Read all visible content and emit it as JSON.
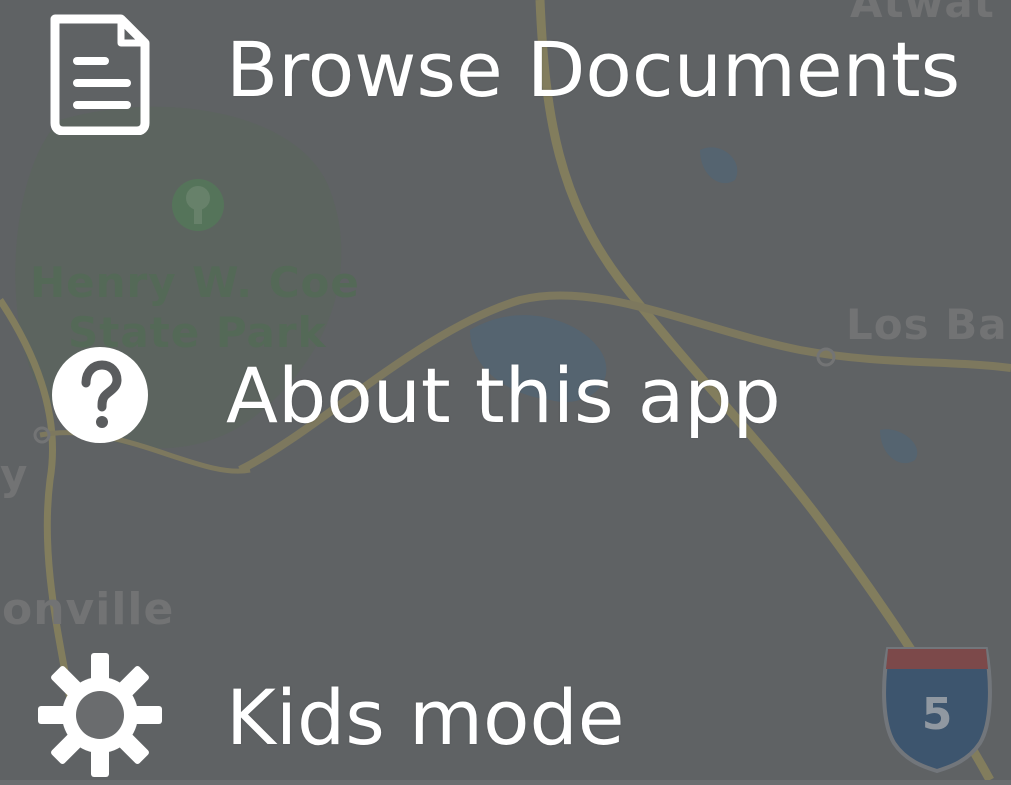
{
  "map": {
    "labels": {
      "top_right": "Atwat",
      "park_line1": "Henry W. Coe",
      "park_line2": "State Park",
      "los_banos": "Los Ba",
      "left_y": "y",
      "onville": "onville"
    },
    "highway_shield": "5",
    "colors": {
      "road": "#a39a67",
      "park": "#667466",
      "water": "#5b7284",
      "shield_blue": "#3a5d82",
      "shield_red": "#9a4a4a"
    }
  },
  "menu": {
    "items": [
      {
        "label": "Browse Documents",
        "icon": "document-icon"
      },
      {
        "label": "About this app",
        "icon": "help-icon"
      },
      {
        "label": "Kids mode",
        "icon": "gear-icon"
      }
    ]
  }
}
